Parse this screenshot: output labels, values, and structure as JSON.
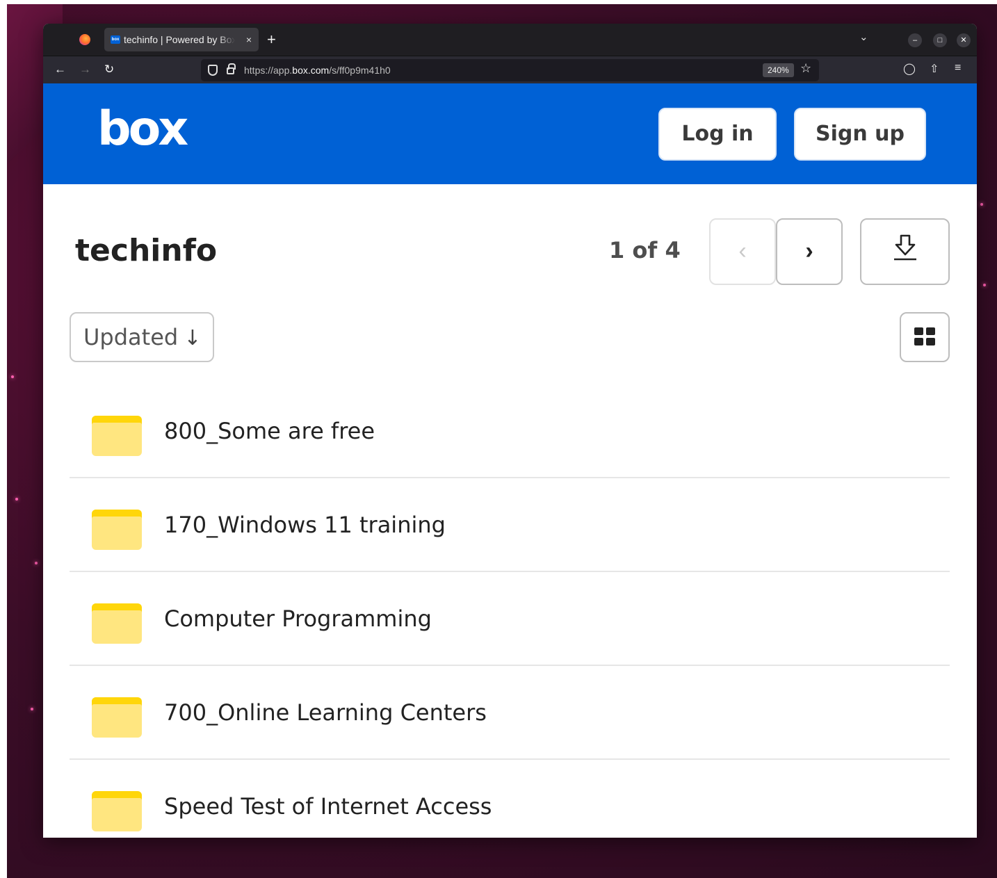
{
  "browser": {
    "tab_title": "techinfo | Powered by Box",
    "tab_close": "×",
    "new_tab": "+",
    "url_prefix": "https://app.",
    "url_domain": "box.com",
    "url_path": "/s/ff0p9m41h0",
    "zoom": "240%"
  },
  "header": {
    "logo": "box",
    "login_label": "Log in",
    "signup_label": "Sign up"
  },
  "folder": {
    "title": "techinfo",
    "pager": "1 of 4",
    "sort_label": "Updated"
  },
  "items": [
    {
      "name": "800_Some are free"
    },
    {
      "name": "170_Windows 11 training"
    },
    {
      "name": "Computer Programming"
    },
    {
      "name": "700_Online Learning Centers"
    },
    {
      "name": "Speed Test of Internet Access"
    }
  ],
  "colors": {
    "brand_blue": "#0061d5",
    "folder_yellow": "#ffe680"
  }
}
